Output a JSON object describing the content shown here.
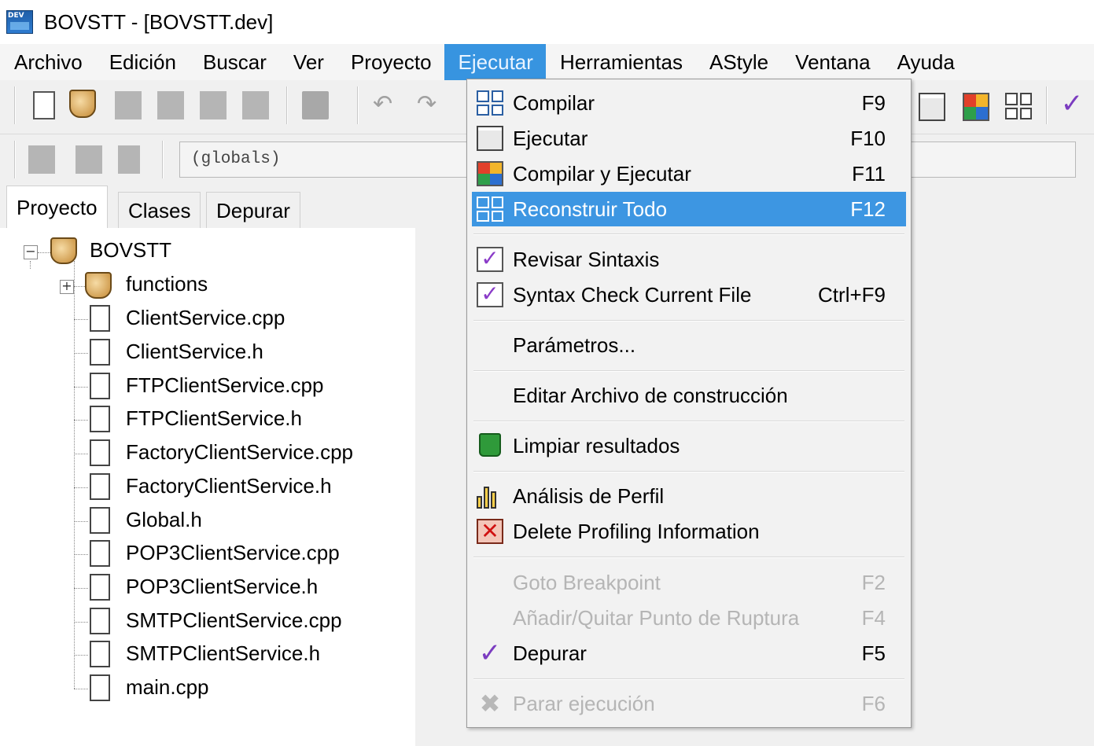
{
  "window": {
    "title": "BOVSTT - [BOVSTT.dev]"
  },
  "menubar": {
    "items": [
      {
        "label": "Archivo"
      },
      {
        "label": "Edición"
      },
      {
        "label": "Buscar"
      },
      {
        "label": "Ver"
      },
      {
        "label": "Proyecto"
      },
      {
        "label": "Ejecutar"
      },
      {
        "label": "Herramientas"
      },
      {
        "label": "AStyle"
      },
      {
        "label": "Ventana"
      },
      {
        "label": "Ayuda"
      }
    ],
    "active": "Ejecutar"
  },
  "toolbar2": {
    "scope_combo": "(globals)"
  },
  "panel": {
    "tabs": [
      {
        "label": "Proyecto"
      },
      {
        "label": "Clases"
      },
      {
        "label": "Depurar"
      }
    ],
    "selected_tab": "Proyecto"
  },
  "tree": {
    "root": "BOVSTT",
    "folder": "functions",
    "files": [
      "ClientService.cpp",
      "ClientService.h",
      "FTPClientService.cpp",
      "FTPClientService.h",
      "FactoryClientService.cpp",
      "FactoryClientService.h",
      "Global.h",
      "POP3ClientService.cpp",
      "POP3ClientService.h",
      "SMTPClientService.cpp",
      "SMTPClientService.h",
      "main.cpp"
    ]
  },
  "menu": {
    "items": [
      {
        "label": "Compilar",
        "shortcut": "F9",
        "icon": "compile-grid-icon"
      },
      {
        "label": "Ejecutar",
        "shortcut": "F10",
        "icon": "window-icon"
      },
      {
        "label": "Compilar y Ejecutar",
        "shortcut": "F11",
        "icon": "colored-window-icon"
      },
      {
        "label": "Reconstruir Todo",
        "shortcut": "F12",
        "icon": "rebuild-grid-icon",
        "highlighted": true
      },
      {
        "label": "Revisar Sintaxis",
        "shortcut": "",
        "icon": "syntax-check-icon"
      },
      {
        "label": "Syntax Check Current File",
        "shortcut": "Ctrl+F9",
        "icon": "syntax-check-file-icon"
      },
      {
        "label": "Parámetros...",
        "shortcut": ""
      },
      {
        "label": "Editar Archivo de construcción",
        "shortcut": ""
      },
      {
        "label": "Limpiar resultados",
        "shortcut": "",
        "icon": "trash-icon"
      },
      {
        "label": "Análisis de Perfil",
        "shortcut": "",
        "icon": "bar-chart-icon"
      },
      {
        "label": "Delete Profiling Information",
        "shortcut": "",
        "icon": "delete-profile-icon"
      },
      {
        "label": "Goto Breakpoint",
        "shortcut": "F2",
        "disabled": true
      },
      {
        "label": "Añadir/Quitar Punto de Ruptura",
        "shortcut": "F4",
        "disabled": true
      },
      {
        "label": "Depurar",
        "shortcut": "F5",
        "icon": "checkmark-icon"
      },
      {
        "label": "Parar ejecución",
        "shortcut": "F6",
        "icon": "stop-x-icon",
        "disabled": true
      }
    ]
  },
  "colors": {
    "menu_highlight": "#3d96e2",
    "menubar_active": "#3794e0",
    "disabled_text": "#b5b5b5"
  }
}
